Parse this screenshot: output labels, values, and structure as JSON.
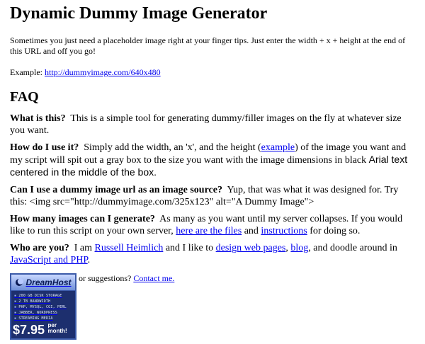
{
  "title": "Dynamic Dummy Image Generator",
  "intro": "Sometimes you just need a placeholder image right at your finger tips. Just enter the width + x + height at the end of this URL and off you go!",
  "example": {
    "label": "Example: ",
    "link": "http://dummyimage.com/640x480"
  },
  "faq_heading": "FAQ",
  "faq": {
    "q1": {
      "q": "What is this?",
      "a": "This is a simple tool for generating dummy/filler images on the fly at whatever size you want."
    },
    "q2": {
      "q": "How do I use it?",
      "a1": "Simply add the width, an 'x', and the height (",
      "link": "example",
      "a2": ") of the image you want and my script will spit out a gray box to the size you want with the image dimensions in black ",
      "font": "Arial text centered in the middle of the box."
    },
    "q3": {
      "q": "Can I use a dummy image url as an image source?",
      "a": "Yup, that was what it was designed for. Try this: <img src=\"http://dummyimage.com/325x123\" alt=\"A Dummy Image\">"
    },
    "q4": {
      "q": "How many images can I generate?",
      "a1": "As many as you want until my server collapses. If you would like to run this script on your own server, ",
      "link1": "here are the files",
      "a2": " and ",
      "link2": "instructions",
      "a3": " for doing so."
    },
    "q5": {
      "q": "Who are you?",
      "a1": "I am ",
      "link1": "Russell Heimlich",
      "a2": " and I like to ",
      "link2": "design web pages",
      "a3": ", ",
      "link3": "blog",
      "a4": ", and doodle around in ",
      "link4": "JavaScript and PHP",
      "a5": "."
    }
  },
  "contact": {
    "text": "Still have questions or suggestions? ",
    "link": "Contact me."
  },
  "banner": {
    "brand": "DreamHost",
    "features": [
      "200 GB DISK STORAGE",
      "2 TB BANDWIDTH",
      "PHP, MYSQL, CGI, PERL",
      "JABBER, WORDPRESS",
      "STREAMING MEDIA"
    ],
    "price": "$7.95",
    "per": "per",
    "month": "month!",
    "colors": {
      "background": "#1d2f6e",
      "border": "#3b5aa8",
      "top": "#6f8fd8"
    }
  },
  "colors": {
    "link": "#0000ee",
    "text": "#000000"
  }
}
